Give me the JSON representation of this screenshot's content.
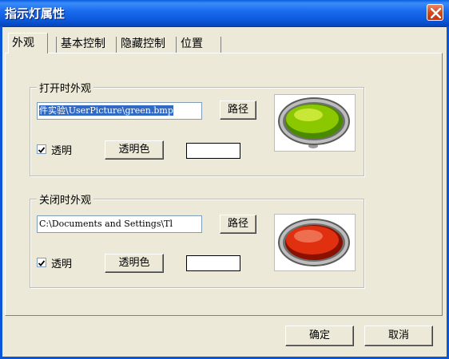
{
  "window": {
    "title": "指示灯属性",
    "title_color": "#0a56d8",
    "close_icon": "close-icon"
  },
  "tabs": [
    {
      "label": "外观",
      "active": true
    },
    {
      "label": "基本控制",
      "active": false
    },
    {
      "label": "隐藏控制",
      "active": false
    },
    {
      "label": "位置",
      "active": false
    }
  ],
  "on_group": {
    "label": "打开时外观",
    "path_value": "件实验\\UserPicture\\green.bmp",
    "path_button": "路径",
    "transparent_checked": true,
    "transparent_label": "透明",
    "transparent_color_button": "透明色",
    "lamp_color": "#8cc800",
    "lamp_icon": "green-lamp-icon"
  },
  "off_group": {
    "label": "关闭时外观",
    "path_value": "C:\\Documents and Settings\\Tl",
    "path_button": "路径",
    "transparent_checked": true,
    "transparent_label": "透明",
    "transparent_color_button": "透明色",
    "lamp_color": "#e03010",
    "lamp_icon": "red-lamp-icon"
  },
  "footer": {
    "ok_label": "确定",
    "cancel_label": "取消"
  }
}
